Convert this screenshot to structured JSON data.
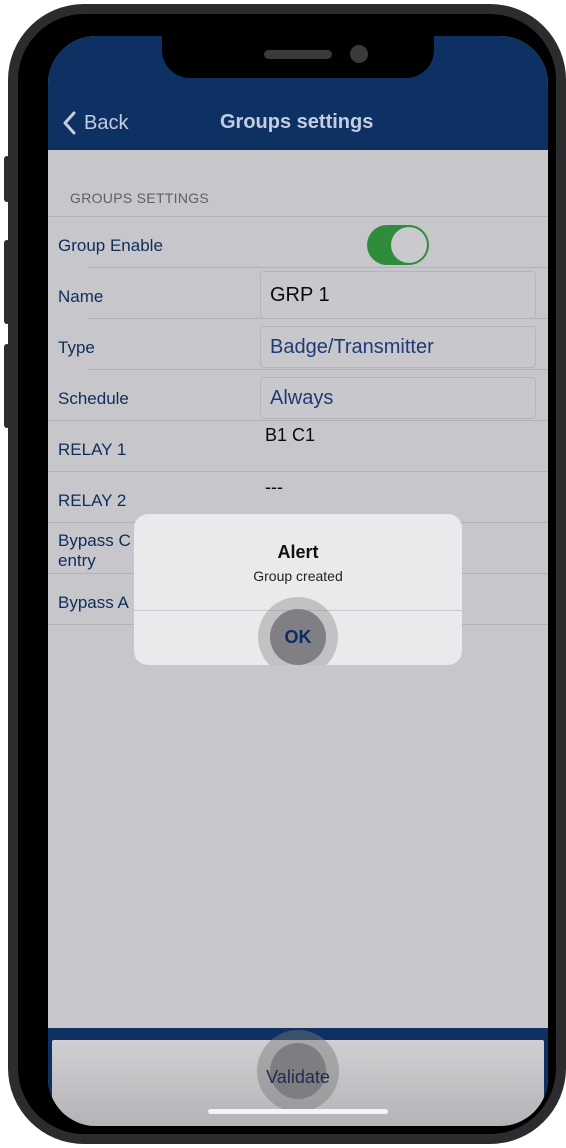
{
  "nav": {
    "back_label": "Back",
    "title": "Groups settings"
  },
  "section": {
    "header": "GROUPS SETTINGS"
  },
  "rows": {
    "group_enable": {
      "label": "Group Enable",
      "on": true
    },
    "name": {
      "label": "Name",
      "value": "GRP 1"
    },
    "type": {
      "label": "Type",
      "value": "Badge/Transmitter"
    },
    "schedule": {
      "label": "Schedule",
      "value": "Always"
    },
    "relay1": {
      "label": "RELAY 1",
      "value": "B1 C1"
    },
    "relay2": {
      "label": "RELAY 2",
      "value": "---"
    },
    "bypass_entry": {
      "label_line1": "Bypass C",
      "label_line2": "entry"
    },
    "bypass_a": {
      "label": "Bypass A"
    }
  },
  "alert": {
    "title": "Alert",
    "message": "Group created",
    "ok_label": "OK"
  },
  "footer": {
    "validate_label": "Validate"
  },
  "colors": {
    "nav_bg": "#0d3163",
    "toggle_on": "#2e8d3d",
    "label_text": "#0e2d5a",
    "link_text": "#1e3a78"
  }
}
